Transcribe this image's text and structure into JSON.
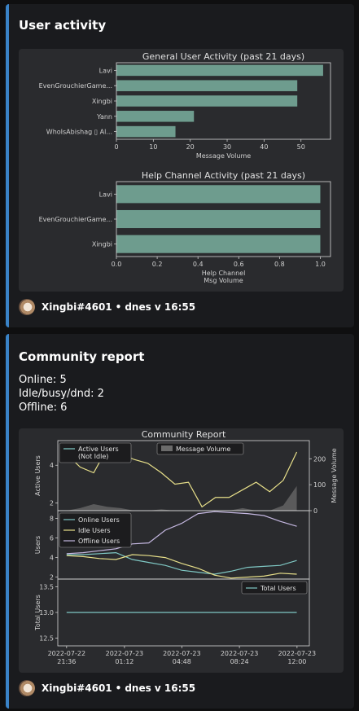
{
  "embed1": {
    "title": "User activity",
    "footer": {
      "author": "Xingbi#4601",
      "sep": "•",
      "time": "dnes v 16:55"
    }
  },
  "embed2": {
    "title": "Community report",
    "stats": [
      "Online: 5",
      "Idle/busy/dnd: 2",
      "Offline: 6"
    ],
    "footer": {
      "author": "Xingbi#4601",
      "sep": "•",
      "time": "dnes v 16:55"
    }
  },
  "colors": {
    "accent": "#3a83c7",
    "bar": "#6e9c8e",
    "teal": "#7fc8c4",
    "yellow": "#e8e08a",
    "lavender": "#c4b7e0",
    "volume": "#6b6b6b"
  },
  "chart_data": [
    {
      "type": "bar",
      "orientation": "horizontal",
      "title": "General User Activity (past 21 days)",
      "xlabel": "Message Volume",
      "categories": [
        "Lavi",
        "EvenGrouchierGame...",
        "Xingbi",
        "Yann",
        "WhoIsAbishag ▯ Al..."
      ],
      "values": [
        56,
        49,
        49,
        21,
        16
      ],
      "xlim": [
        0,
        58
      ],
      "xticks": [
        "0",
        "10",
        "20",
        "30",
        "40",
        "50"
      ]
    },
    {
      "type": "bar",
      "orientation": "horizontal",
      "title": "Help Channel Activity (past 21 days)",
      "xlabel": "Help Channel\nMsg Volume",
      "categories": [
        "Lavi",
        "EvenGrouchierGame...",
        "Xingbi"
      ],
      "values": [
        1.0,
        1.0,
        1.0
      ],
      "xlim": [
        0,
        1.05
      ],
      "xticks": [
        "0.0",
        "0.2",
        "0.4",
        "0.6",
        "0.8",
        "1.0"
      ]
    },
    {
      "type": "line",
      "title": "Community Report",
      "x": [
        "2022-07-22 21:36",
        "2022-07-22 22:30",
        "2022-07-22 23:30",
        "2022-07-23 00:20",
        "2022-07-23 01:12",
        "2022-07-23 02:00",
        "2022-07-23 02:50",
        "2022-07-23 03:40",
        "2022-07-23 04:48",
        "2022-07-23 05:40",
        "2022-07-23 06:30",
        "2022-07-23 07:20",
        "2022-07-23 08:24",
        "2022-07-23 09:20",
        "2022-07-23 10:10",
        "2022-07-23 11:00",
        "2022-07-23 12:00",
        "2022-07-23 12:50",
        "2022-07-23 13:40"
      ],
      "xtick_labels": [
        [
          "2022-07-22",
          "21:36"
        ],
        [
          "2022-07-23",
          "01:12"
        ],
        [
          "2022-07-23",
          "04:48"
        ],
        [
          "2022-07-23",
          "08:24"
        ],
        [
          "2022-07-23",
          "12:00"
        ]
      ],
      "panels": [
        {
          "ylabel": "Active Users",
          "ylabel_right": "Message Volume",
          "ylim": [
            1.6,
            5.3
          ],
          "yticks": [
            "2",
            "4"
          ],
          "ylim_right": [
            0,
            270
          ],
          "yticks_right": [
            "0",
            "100",
            "200"
          ],
          "legend": [
            "Active Users\n(Not Idle)",
            "Message Volume"
          ],
          "series": [
            {
              "name": "Active Users\n(Not Idle)",
              "values": [
                4.6,
                3.9,
                3.6,
                4.9,
                4.6,
                4.3,
                4.1,
                3.6,
                3.0,
                3.1,
                1.8,
                2.3,
                2.3,
                2.7,
                3.1,
                2.6,
                3.2,
                4.7
              ]
            },
            {
              "name": "Message Volume",
              "area": true,
              "values": [
                0,
                10,
                25,
                15,
                10,
                0,
                0,
                5,
                0,
                0,
                0,
                0,
                0,
                10,
                0,
                0,
                20,
                95
              ]
            }
          ]
        },
        {
          "ylabel": "Users",
          "ylim": [
            1.8,
            8.8
          ],
          "yticks": [
            "2",
            "4",
            "6",
            "8"
          ],
          "legend": [
            "Online Users",
            "Idle Users",
            "Offline Users"
          ],
          "series": [
            {
              "name": "Online Users",
              "values": [
                4.3,
                4.3,
                4.4,
                4.5,
                3.8,
                3.5,
                3.2,
                2.7,
                2.5,
                2.3,
                2.6,
                3.0,
                3.1,
                3.2,
                3.7
              ]
            },
            {
              "name": "Idle Users",
              "values": [
                4.2,
                4.1,
                3.9,
                3.8,
                4.3,
                4.2,
                4.0,
                3.4,
                2.9,
                2.2,
                1.9,
                2.0,
                2.1,
                2.4,
                2.3
              ]
            },
            {
              "name": "Offline Users",
              "values": [
                4.4,
                4.5,
                4.7,
                4.9,
                5.4,
                5.5,
                6.8,
                7.5,
                8.5,
                8.7,
                8.6,
                8.5,
                8.3,
                7.7,
                7.2
              ]
            }
          ]
        },
        {
          "ylabel": "Total Users",
          "ylim": [
            12.35,
            13.65
          ],
          "yticks": [
            "12.5",
            "13.0",
            "13.5"
          ],
          "legend": [
            "Total Users"
          ],
          "series": [
            {
              "name": "Total Users",
              "values": [
                13,
                13
              ]
            }
          ]
        }
      ]
    }
  ]
}
